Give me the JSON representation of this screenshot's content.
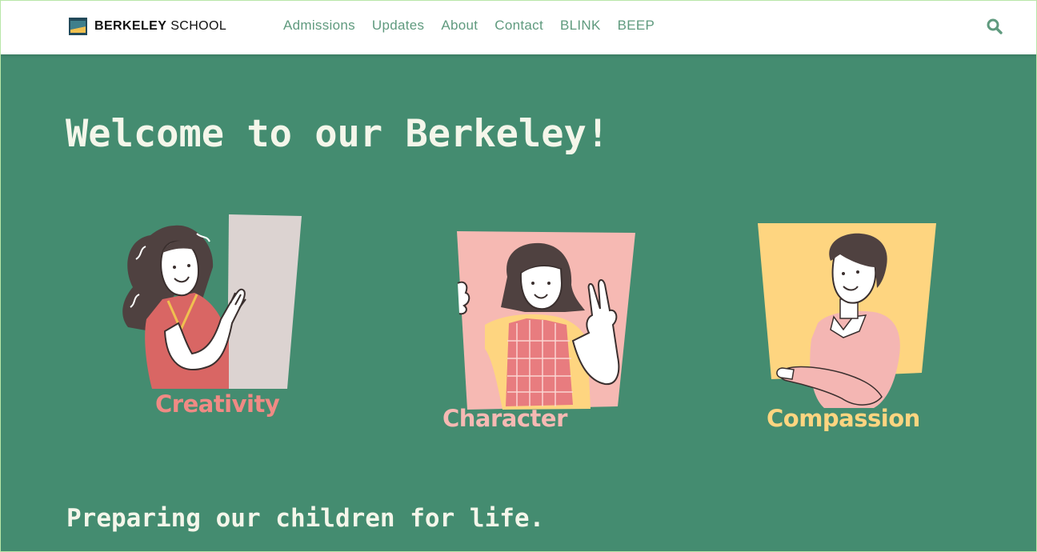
{
  "brand": {
    "bold": "BERKELEY",
    "light": "SCHOOL",
    "colors": {
      "dark": "#234a5a",
      "accent": "#f0c050"
    }
  },
  "nav": {
    "items": [
      {
        "label": "Admissions"
      },
      {
        "label": "Updates"
      },
      {
        "label": "About"
      },
      {
        "label": "Contact"
      },
      {
        "label": "BLINK"
      },
      {
        "label": "BEEP"
      }
    ],
    "search_icon": "search-icon"
  },
  "hero": {
    "title": "Welcome to our Berkeley!",
    "tagline": "Preparing our children for life."
  },
  "values": [
    {
      "label": "Creativity",
      "color": "#f08a84",
      "illustration": "girl-waving-illustration"
    },
    {
      "label": "Character",
      "color": "#f6b9b3",
      "illustration": "girl-peace-sign-illustration"
    },
    {
      "label": "Compassion",
      "color": "#fed580",
      "illustration": "boy-leaning-illustration"
    }
  ],
  "theme": {
    "background": "#448c70",
    "nav_link": "#5f9a7e",
    "heading": "#f4f6ea"
  }
}
